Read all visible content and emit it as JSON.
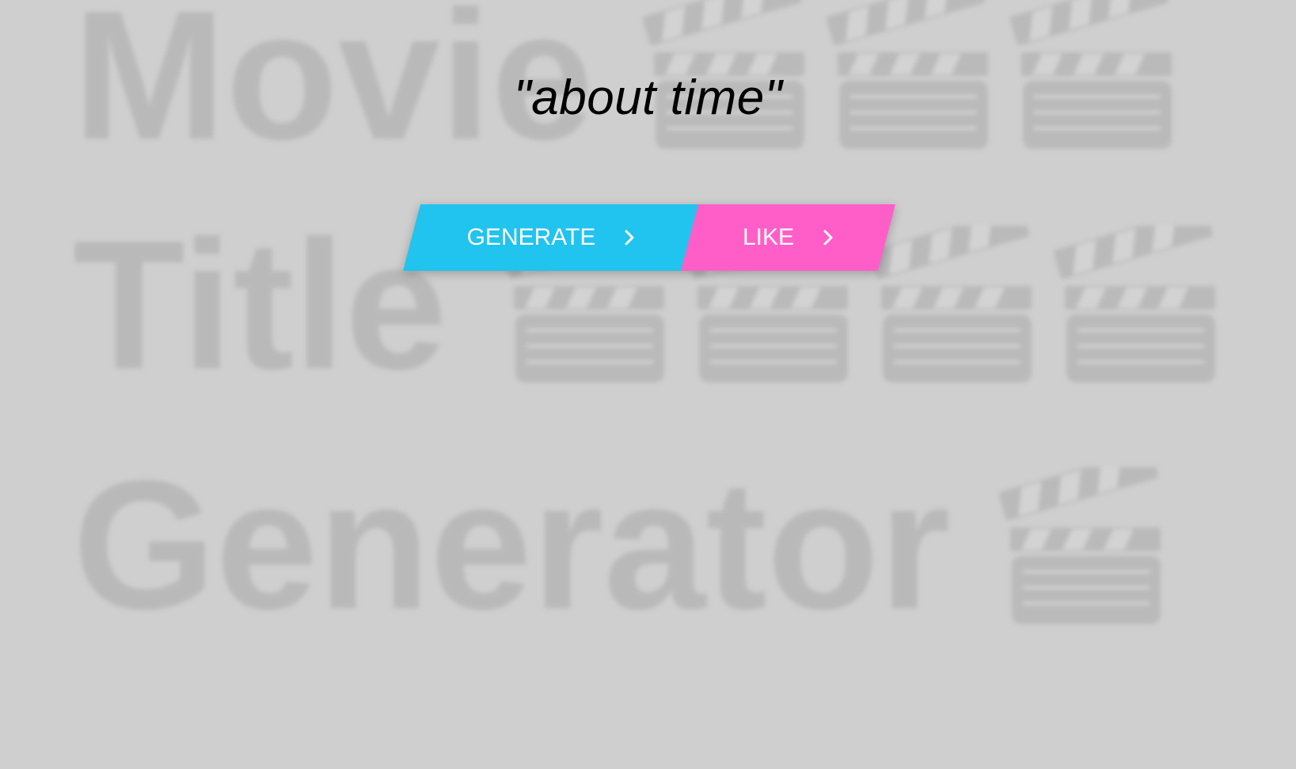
{
  "background": {
    "lines": [
      "Movie",
      "Title",
      "Generator"
    ],
    "icon": "clapperboard-icon",
    "text_color": "#b9b9b9",
    "bg_color": "#cfcfcf"
  },
  "generated_title": "\"about time\"",
  "buttons": {
    "generate": {
      "label": "GENERATE",
      "icon": "chevron-right-icon",
      "color": "#21c3ef"
    },
    "like": {
      "label": "LIKE",
      "icon": "chevron-right-icon",
      "color": "#ff5ec8"
    }
  }
}
